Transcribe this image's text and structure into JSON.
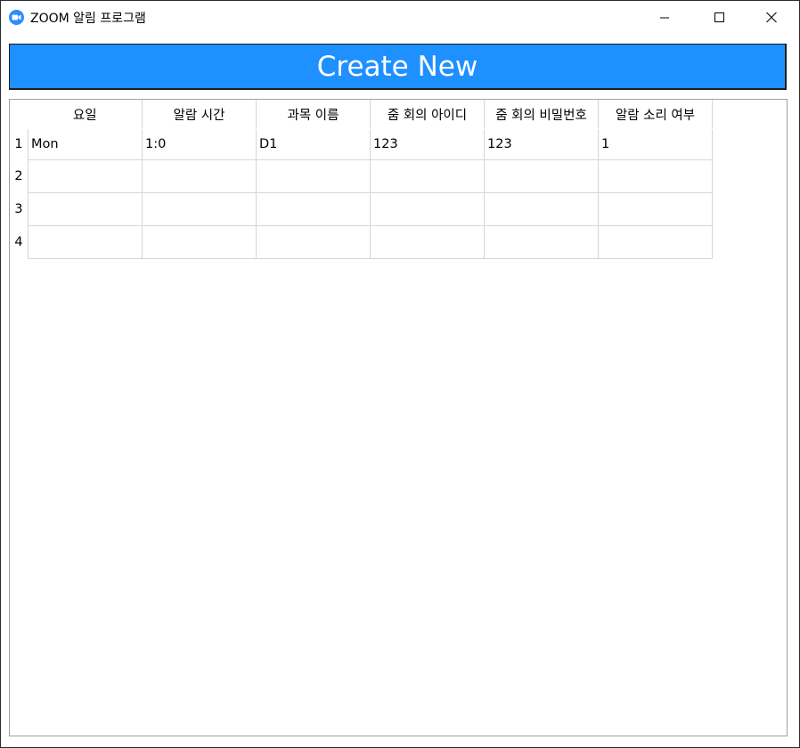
{
  "window": {
    "title": "ZOOM 알림 프로그램",
    "app_icon": "zoom-camera-icon",
    "controls": [
      "minimize-icon",
      "maximize-icon",
      "close-icon"
    ]
  },
  "create_button": {
    "label": "Create New",
    "color": "#1e90ff"
  },
  "table": {
    "columns": [
      "요일",
      "알람 시간",
      "과목 이름",
      "줌 회의 아이디",
      "줌 회의 비밀번호",
      "알람 소리 여부"
    ],
    "rows": [
      {
        "num": "1",
        "cells": [
          "Mon",
          "1:0",
          "D1",
          "123",
          "123",
          "1"
        ]
      },
      {
        "num": "2",
        "cells": [
          "",
          "",
          "",
          "",
          "",
          ""
        ]
      },
      {
        "num": "3",
        "cells": [
          "",
          "",
          "",
          "",
          "",
          ""
        ]
      },
      {
        "num": "4",
        "cells": [
          "",
          "",
          "",
          "",
          "",
          ""
        ]
      }
    ]
  }
}
